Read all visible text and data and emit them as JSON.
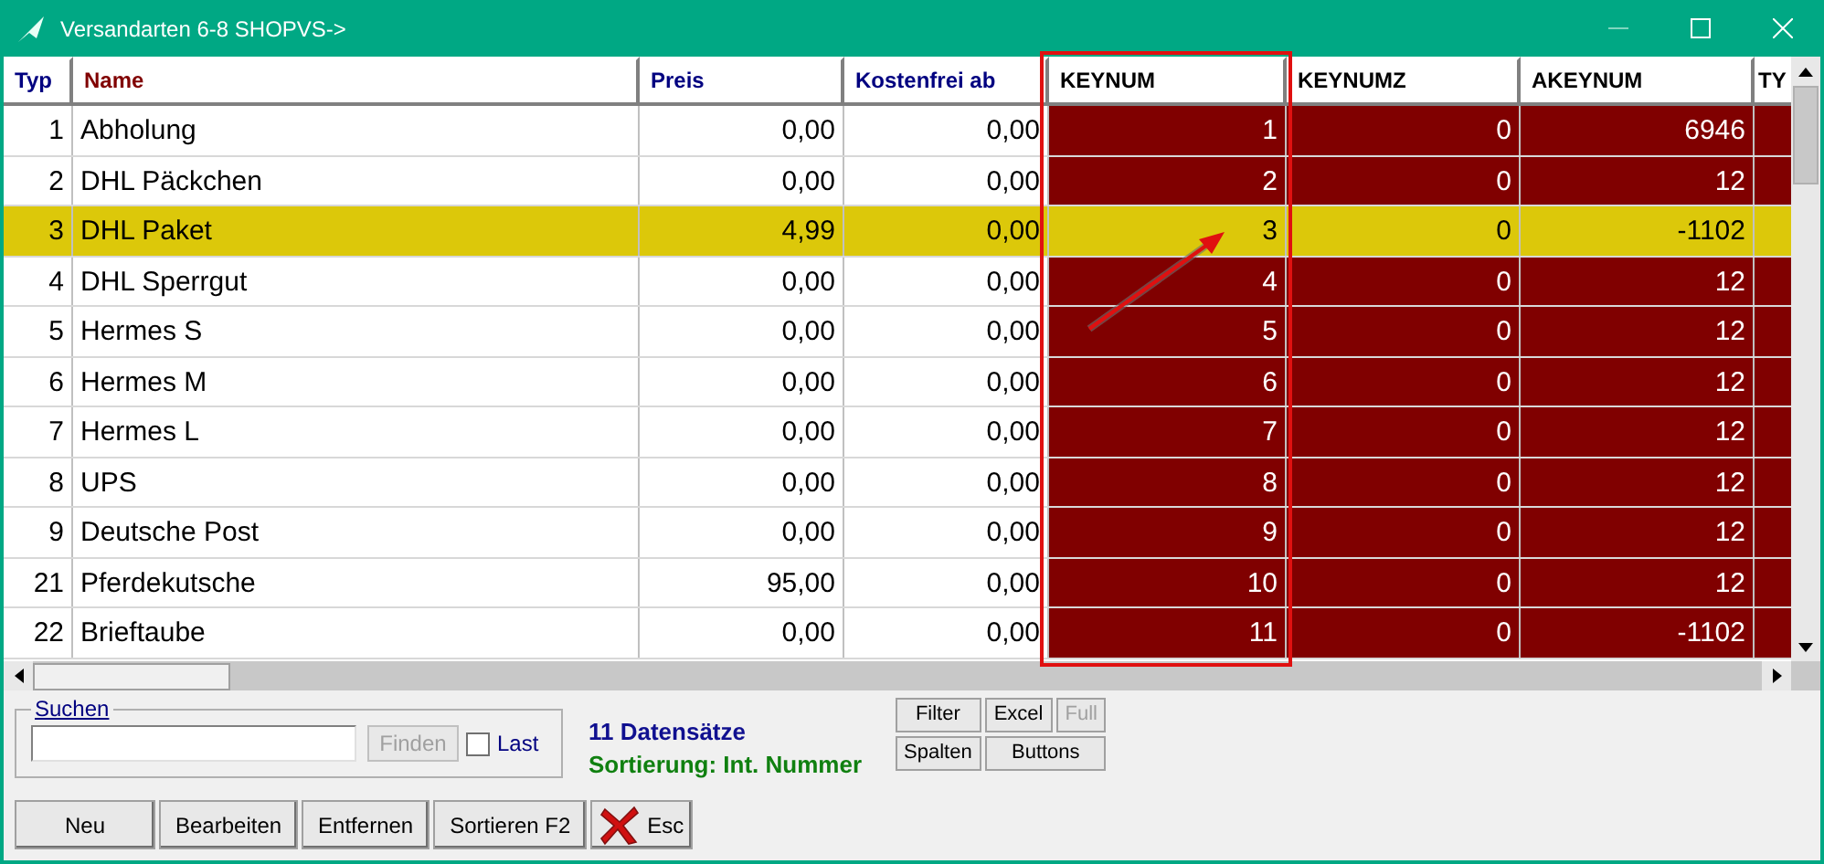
{
  "window": {
    "title": "Versandarten 6-8 SHOPVS->"
  },
  "table": {
    "columns": [
      {
        "label": "Typ",
        "color": "#000080"
      },
      {
        "label": "Name",
        "color": "#800000"
      },
      {
        "label": "Preis",
        "color": "#000080"
      },
      {
        "label": "Kostenfrei ab",
        "color": "#000080"
      },
      {
        "label": "KEYNUM",
        "color": "#000000"
      },
      {
        "label": "KEYNUMZ",
        "color": "#000000"
      },
      {
        "label": "AKEYNUM",
        "color": "#000000"
      },
      {
        "label": "TY",
        "color": "#000000"
      }
    ],
    "rows": [
      {
        "selected": false,
        "cells": [
          "1",
          "Abholung",
          "0,00",
          "0,00",
          "1",
          "0",
          "6946"
        ]
      },
      {
        "selected": false,
        "cells": [
          "2",
          "DHL Päckchen",
          "0,00",
          "0,00",
          "2",
          "0",
          "12"
        ]
      },
      {
        "selected": true,
        "cells": [
          "3",
          "DHL Paket",
          "4,99",
          "0,00",
          "3",
          "0",
          "-1102"
        ]
      },
      {
        "selected": false,
        "cells": [
          "4",
          "DHL Sperrgut",
          "0,00",
          "0,00",
          "4",
          "0",
          "12"
        ]
      },
      {
        "selected": false,
        "cells": [
          "5",
          "Hermes S",
          "0,00",
          "0,00",
          "5",
          "0",
          "12"
        ]
      },
      {
        "selected": false,
        "cells": [
          "6",
          "Hermes M",
          "0,00",
          "0,00",
          "6",
          "0",
          "12"
        ]
      },
      {
        "selected": false,
        "cells": [
          "7",
          "Hermes L",
          "0,00",
          "0,00",
          "7",
          "0",
          "12"
        ]
      },
      {
        "selected": false,
        "cells": [
          "8",
          "UPS",
          "0,00",
          "0,00",
          "8",
          "0",
          "12"
        ]
      },
      {
        "selected": false,
        "cells": [
          "9",
          "Deutsche Post",
          "0,00",
          "0,00",
          "9",
          "0",
          "12"
        ]
      },
      {
        "selected": false,
        "cells": [
          "21",
          "Pferdekutsche",
          "95,00",
          "0,00",
          "10",
          "0",
          "12"
        ]
      },
      {
        "selected": false,
        "cells": [
          "22",
          "Brieftaube",
          "0,00",
          "0,00",
          "11",
          "0",
          "-1102"
        ]
      }
    ]
  },
  "search": {
    "label": "Suchen",
    "find_button": {
      "label": "Finden",
      "disabled": true
    },
    "last": {
      "label": "Last",
      "checked": false
    }
  },
  "status": {
    "count": "11 Datensätze",
    "sort": "Sortierung: Int. Nummer"
  },
  "tool_buttons": [
    {
      "label": "Filter",
      "disabled": false
    },
    {
      "label": "Excel",
      "disabled": false
    },
    {
      "label": "Full",
      "disabled": true
    },
    {
      "label": "Spalten",
      "disabled": false
    },
    {
      "label": "Buttons",
      "disabled": false
    }
  ],
  "buttons": [
    {
      "label": "Neu",
      "kind": "text"
    },
    {
      "label": "Bearbeiten",
      "kind": "text"
    },
    {
      "label": "Entfernen",
      "kind": "text"
    },
    {
      "label": "Sortieren F2",
      "kind": "text"
    },
    {
      "label": "Esc",
      "kind": "cancel"
    }
  ]
}
